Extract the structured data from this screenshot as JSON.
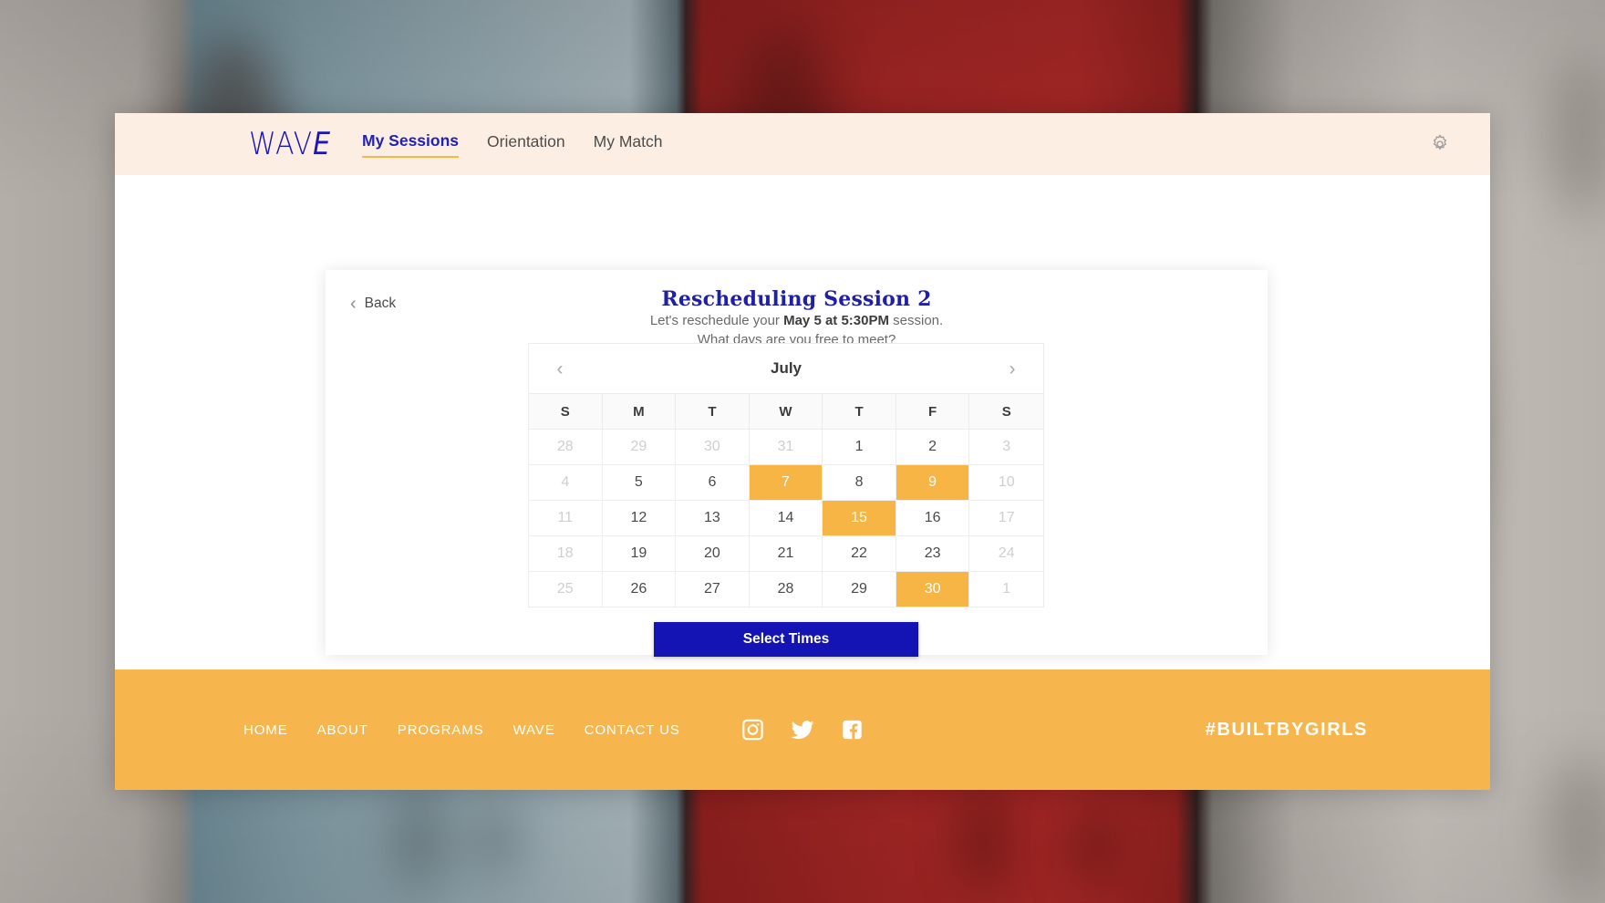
{
  "topnav": {
    "logo": "WAV",
    "logo_italic": "E",
    "links": [
      {
        "label": "My Sessions",
        "active": true
      },
      {
        "label": "Orientation",
        "active": false
      },
      {
        "label": "My Match",
        "active": false
      }
    ],
    "settings_icon": "gear-icon"
  },
  "card": {
    "back_label": "Back",
    "back_icon": "chevron-left-icon",
    "title": "Rescheduling Session 2",
    "subtitle_prefix": "Let's reschedule your ",
    "subtitle_strong": "May 5 at 5:30PM",
    "subtitle_suffix": " session.",
    "subtitle_line2": "What days are you free to meet?",
    "submit_label": "Select Times"
  },
  "calendar": {
    "month": "July",
    "prev_icon": "chevron-left-icon",
    "next_icon": "chevron-right-icon",
    "weekdays": [
      "S",
      "M",
      "T",
      "W",
      "T",
      "F",
      "S"
    ],
    "weeks": [
      [
        {
          "d": "28",
          "state": "muted"
        },
        {
          "d": "29",
          "state": "muted"
        },
        {
          "d": "30",
          "state": "muted"
        },
        {
          "d": "31",
          "state": "muted"
        },
        {
          "d": "1",
          "state": "normal"
        },
        {
          "d": "2",
          "state": "normal"
        },
        {
          "d": "3",
          "state": "muted"
        }
      ],
      [
        {
          "d": "4",
          "state": "muted"
        },
        {
          "d": "5",
          "state": "normal"
        },
        {
          "d": "6",
          "state": "normal"
        },
        {
          "d": "7",
          "state": "selected"
        },
        {
          "d": "8",
          "state": "normal"
        },
        {
          "d": "9",
          "state": "selected"
        },
        {
          "d": "10",
          "state": "muted"
        }
      ],
      [
        {
          "d": "11",
          "state": "muted"
        },
        {
          "d": "12",
          "state": "normal"
        },
        {
          "d": "13",
          "state": "normal"
        },
        {
          "d": "14",
          "state": "normal"
        },
        {
          "d": "15",
          "state": "selected"
        },
        {
          "d": "16",
          "state": "normal"
        },
        {
          "d": "17",
          "state": "muted"
        }
      ],
      [
        {
          "d": "18",
          "state": "muted"
        },
        {
          "d": "19",
          "state": "normal"
        },
        {
          "d": "20",
          "state": "normal"
        },
        {
          "d": "21",
          "state": "normal"
        },
        {
          "d": "22",
          "state": "normal"
        },
        {
          "d": "23",
          "state": "normal"
        },
        {
          "d": "24",
          "state": "muted"
        }
      ],
      [
        {
          "d": "25",
          "state": "muted"
        },
        {
          "d": "26",
          "state": "normal"
        },
        {
          "d": "27",
          "state": "normal"
        },
        {
          "d": "28",
          "state": "normal"
        },
        {
          "d": "29",
          "state": "normal"
        },
        {
          "d": "30",
          "state": "selected"
        },
        {
          "d": "1",
          "state": "muted"
        }
      ]
    ]
  },
  "footer": {
    "links": [
      "HOME",
      "ABOUT",
      "PROGRAMS",
      "WAVE",
      "CONTACT US"
    ],
    "socials": [
      "instagram-icon",
      "twitter-icon",
      "facebook-icon"
    ],
    "hashtag": "#BUILTBYGIRLS"
  },
  "colors": {
    "accent_orange": "#f6b545",
    "brand_blue": "#1f1fa8",
    "button_blue": "#1414b4",
    "nav_bg": "#fceee3",
    "footer_bg": "#f7b64d"
  }
}
